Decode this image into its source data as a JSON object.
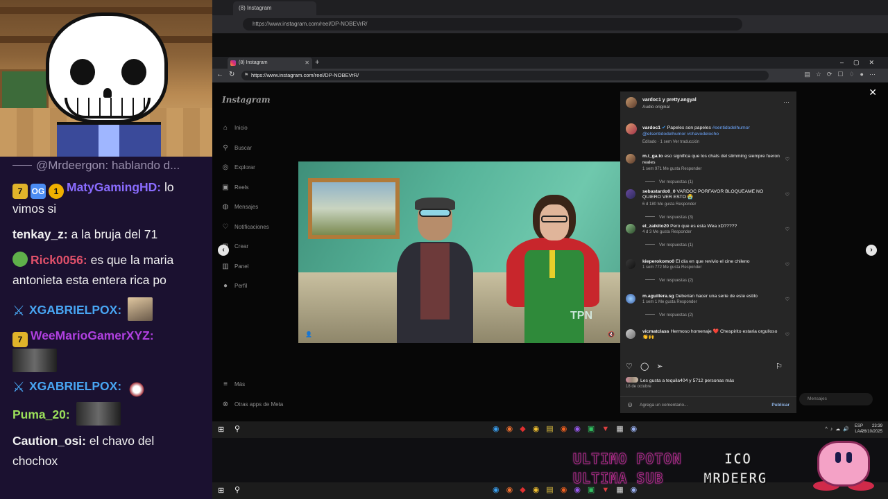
{
  "stream": {
    "chat": [
      {
        "user": "@Mrdeergon:",
        "text": "hablando d...",
        "color": "#9a90ad",
        "badges": []
      },
      {
        "user": "MatyGamingHD:",
        "text": "lo vimos si",
        "color": "#8a6cff",
        "badges": [
          "7",
          "OG",
          "1"
        ]
      },
      {
        "user": "tenkay_z:",
        "text": "a la bruja del 71",
        "color": "#f2f2f2",
        "badges": []
      },
      {
        "user": "Rick0056:",
        "text": "es que la maria antonieta esta entera rica po",
        "color": "#e0506a",
        "badges": [
          "pepe"
        ]
      },
      {
        "user": "XGABRIELPOX:",
        "text": "",
        "color": "#48a5f2",
        "badges": [
          "sword"
        ]
      },
      {
        "user": "WeeMarioGamerXYZ:",
        "text": "",
        "color": "#b040e0",
        "badges": [
          "7"
        ]
      },
      {
        "user": "XGABRIELPOX:",
        "text": "",
        "color": "#48a5f2",
        "badges": [
          "sword"
        ]
      },
      {
        "user": "Puma_20:",
        "text": "",
        "color": "#9be05a",
        "badges": []
      },
      {
        "user": "Caution_osi:",
        "text": "el chavo del chochox",
        "color": "#f2f2f2",
        "badges": []
      }
    ],
    "overlay": {
      "line1": "ULTIMO POTON",
      "line1_right": "ICO",
      "line2": "ULTIMA SUB",
      "line2_right": "MRDEERG"
    }
  },
  "outer_browser": {
    "tab_title": "(8) Instagram",
    "url": "https://www.instagram.com/reel/DP-NOBEVrR/"
  },
  "browser": {
    "tab_title": "(8) Instagram",
    "url": "https://www.instagram.com/reel/DP-NOBEVrR/"
  },
  "instagram": {
    "logo": "Instagram",
    "nav": [
      {
        "label": "Inicio",
        "icon": "home-icon",
        "glyph": "⌂"
      },
      {
        "label": "Buscar",
        "icon": "search-icon",
        "glyph": "⚲"
      },
      {
        "label": "Explorar",
        "icon": "compass-icon",
        "glyph": "◎"
      },
      {
        "label": "Reels",
        "icon": "reels-icon",
        "glyph": "▣"
      },
      {
        "label": "Mensajes",
        "icon": "messages-icon",
        "glyph": "◍"
      },
      {
        "label": "Notificaciones",
        "icon": "heart-icon",
        "glyph": "♡"
      },
      {
        "label": "Crear",
        "icon": "plus-icon",
        "glyph": "⊞"
      },
      {
        "label": "Panel",
        "icon": "chart-icon",
        "glyph": "▥"
      },
      {
        "label": "Perfil",
        "icon": "profile-icon",
        "glyph": "●"
      }
    ],
    "nav_bottom": [
      {
        "label": "Más",
        "icon": "menu-icon",
        "glyph": "≡"
      },
      {
        "label": "Otras apps de Meta",
        "icon": "meta-icon",
        "glyph": "⊗"
      }
    ],
    "video_watermark": "TPN",
    "post": {
      "author": "vardoc1 y pretty.angyal",
      "audio": "Audio original",
      "caption_user": "vardoc1",
      "caption_text": "Papeles son papeles",
      "caption_tags": "#sentidodelhumor @elsentidodelhumor #chavodelocho",
      "caption_meta": "Editado · 1 sem    Ver traducción",
      "likes": "Les gusta a tequila404 y 5712 personas más",
      "date": "18 de octubre",
      "comment_placeholder": "Agrega un comentario...",
      "publish": "Publicar"
    },
    "comments": [
      {
        "user": "m.i_ga.to",
        "text": "eso significa que los chats del slimming siempre fueron reales",
        "meta": "1 sem    971 Me gusta    Responder",
        "replies": "Ver respuestas (1)"
      },
      {
        "user": "sebastardo0_0",
        "text": "VARDOC PORFAVOR BLOQUEAME NO QUIERO VER ESTO 😭",
        "meta": "6 d    180 Me gusta    Responder",
        "replies": "Ver respuestas (3)"
      },
      {
        "user": "el_zaikito20",
        "text": "Pero que es esta Wea xD?????",
        "meta": "4 d    3 Me gusta    Responder",
        "replies": "Ver respuestas (1)"
      },
      {
        "user": "kieperokomo0",
        "text": "El día en que revivio el cine chileno",
        "meta": "1 sem    772 Me gusta    Responder",
        "replies": "Ver respuestas (2)"
      },
      {
        "user": "m.aguillera.sg",
        "text": "Deberian hacer una serie de este estilo",
        "meta": "1 sem    1 Me gusta    Responder",
        "replies": "Ver respuestas (2)"
      },
      {
        "user": "vicmatclass",
        "text": "Hermoso homenaje ❤️ Chespirito estaria orgulloso 👏🙌",
        "meta": "",
        "replies": ""
      }
    ],
    "messages_pill": "Mensajes"
  },
  "taskbar": {
    "lang_top": "ESP",
    "lang_bottom": "LAA",
    "time": "23:39",
    "date": "26/10/2025"
  }
}
